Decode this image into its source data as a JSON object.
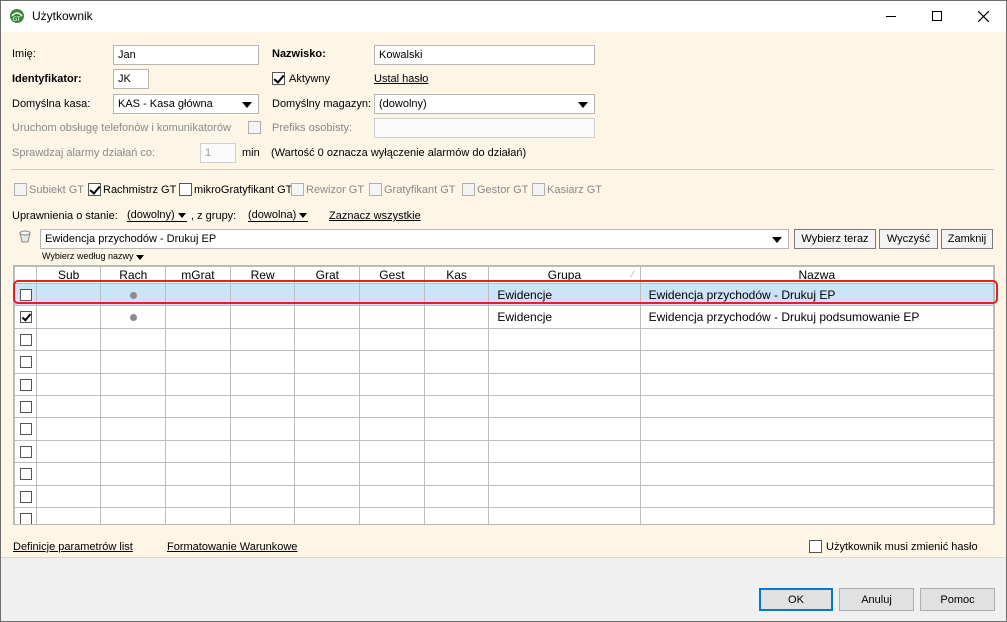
{
  "window": {
    "title": "Użytkownik",
    "app_icon": "gt-app-icon"
  },
  "form": {
    "imie_label": "Imię:",
    "imie_value": "Jan",
    "nazwisko_label": "Nazwisko:",
    "nazwisko_value": "Kowalski",
    "identyfikator_label": "Identyfikator:",
    "identyfikator_value": "JK",
    "aktywny_label": "Aktywny",
    "ustal_haslo": "Ustal hasło",
    "kasa_label": "Domyślna kasa:",
    "kasa_value": "KAS - Kasa główna",
    "magazyn_label": "Domyślny magazyn:",
    "magazyn_value": "(dowolny)",
    "telefony_label": "Uruchom obsługę telefonów i komunikatorów",
    "prefiks_label": "Prefiks osobisty:",
    "alarmy_label": "Sprawdzaj alarmy działań co:",
    "alarmy_value": "1",
    "alarmy_unit": "min",
    "alarmy_note": "(Wartość 0 oznacza wyłączenie alarmów do działań)"
  },
  "modules": [
    {
      "label": "Subiekt GT",
      "checked": false,
      "enabled": false
    },
    {
      "label": "Rachmistrz GT",
      "checked": true,
      "enabled": true
    },
    {
      "label": "mikroGratyfikant GT",
      "checked": false,
      "enabled": true
    },
    {
      "label": "Rewizor GT",
      "checked": false,
      "enabled": false
    },
    {
      "label": "Gratyfikant GT",
      "checked": false,
      "enabled": false
    },
    {
      "label": "Gestor GT",
      "checked": false,
      "enabled": false
    },
    {
      "label": "Kasiarz GT",
      "checked": false,
      "enabled": false
    }
  ],
  "filter": {
    "uprawnienia_label": "Uprawnienia o stanie:",
    "stan_value": "(dowolny)",
    "grupa_label": ", z grupy:",
    "grupa_value": "(dowolna)",
    "zaznacz": "Zaznacz wszystkie",
    "search_value": "Ewidencja przychodów - Drukuj EP",
    "wybierz_wedlug": "Wybierz według nazwy",
    "btn_wybierz": "Wybierz teraz",
    "btn_wyczysc": "Wyczyść",
    "btn_zamknij": "Zamknij"
  },
  "grid": {
    "columns": [
      "",
      "Sub",
      "Rach",
      "mGrat",
      "Rew",
      "Grat",
      "Gest",
      "Kas",
      "Grupa",
      "Nazwa"
    ],
    "rows": [
      {
        "checked": false,
        "rach": true,
        "grupa": "Ewidencje",
        "nazwa": "Ewidencja przychodów - Drukuj EP",
        "selected": true
      },
      {
        "checked": true,
        "rach": true,
        "grupa": "Ewidencje",
        "nazwa": "Ewidencja przychodów - Drukuj podsumowanie EP",
        "selected": false
      },
      {
        "checked": false,
        "rach": false,
        "grupa": "",
        "nazwa": "",
        "selected": false
      },
      {
        "checked": false,
        "rach": false,
        "grupa": "",
        "nazwa": "",
        "selected": false
      },
      {
        "checked": false,
        "rach": false,
        "grupa": "",
        "nazwa": "",
        "selected": false
      },
      {
        "checked": false,
        "rach": false,
        "grupa": "",
        "nazwa": "",
        "selected": false
      },
      {
        "checked": false,
        "rach": false,
        "grupa": "",
        "nazwa": "",
        "selected": false
      },
      {
        "checked": false,
        "rach": false,
        "grupa": "",
        "nazwa": "",
        "selected": false
      },
      {
        "checked": false,
        "rach": false,
        "grupa": "",
        "nazwa": "",
        "selected": false
      },
      {
        "checked": false,
        "rach": false,
        "grupa": "",
        "nazwa": "",
        "selected": false
      },
      {
        "checked": false,
        "rach": false,
        "grupa": "",
        "nazwa": "",
        "selected": false
      },
      {
        "checked": false,
        "rach": false,
        "grupa": "",
        "nazwa": "",
        "selected": false
      }
    ]
  },
  "bottom": {
    "definicje": "Definicje parametrów list",
    "formatowanie": "Formatowanie Warunkowe",
    "musi_zmienic": "Użytkownik musi zmienić hasło"
  },
  "buttons": {
    "ok": "OK",
    "anuluj": "Anuluj",
    "pomoc": "Pomoc"
  },
  "colors": {
    "panel_bg": "#fdf5e6",
    "selection": "#cce4f7",
    "highlight": "#e81e25"
  }
}
